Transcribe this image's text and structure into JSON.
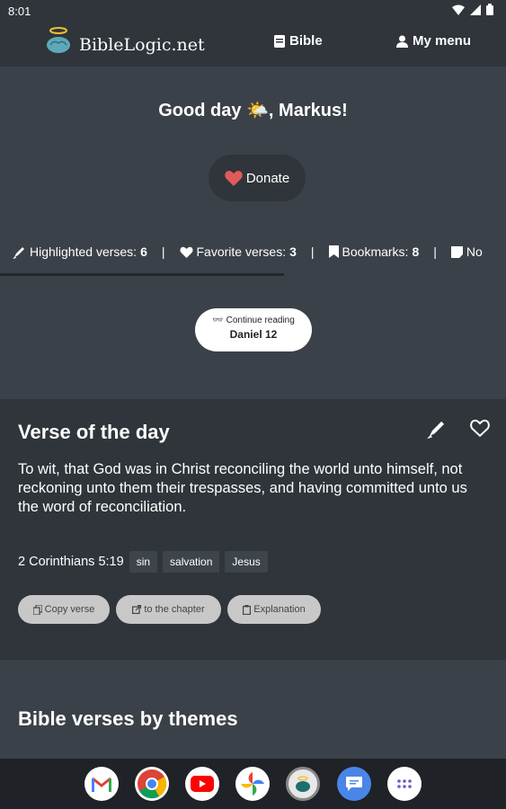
{
  "status_bar": {
    "time": "8:01"
  },
  "header": {
    "logo_text": "BibleLogic.net",
    "nav": {
      "bible": "Bible",
      "my_menu": "My menu"
    }
  },
  "greeting": {
    "text": "Good day 🌤️, Markus!"
  },
  "donate": {
    "label": "Donate"
  },
  "stats": {
    "highlighted_label": "Highlighted verses:",
    "highlighted_count": "6",
    "favorite_label": "Favorite verses:",
    "favorite_count": "3",
    "bookmarks_label": "Bookmarks:",
    "bookmarks_count": "8",
    "notes_label": "No"
  },
  "continue_reading": {
    "label": "Continue reading",
    "book": "Daniel 12"
  },
  "verse_of_the_day": {
    "title": "Verse of the day",
    "text": "To wit, that God was in Christ reconciling the world unto himself, not reckoning unto them their trespasses, and having committed unto us the word of reconciliation.",
    "reference": "2 Corinthians 5:19",
    "tags": [
      "sin",
      "salvation",
      "Jesus"
    ],
    "buttons": {
      "copy": "Copy verse",
      "chapter": "to the chapter",
      "explanation": "Explanation"
    }
  },
  "themes": {
    "title": "Bible verses by themes"
  },
  "dock": {
    "apps": [
      "gmail-icon",
      "chrome-icon",
      "youtube-icon",
      "photos-icon",
      "biblelogic-app-icon",
      "messages-icon",
      "app-drawer-icon"
    ]
  },
  "colors": {
    "bg": "#3b4148",
    "dark": "#30353b",
    "heart": "#e05a5a"
  }
}
